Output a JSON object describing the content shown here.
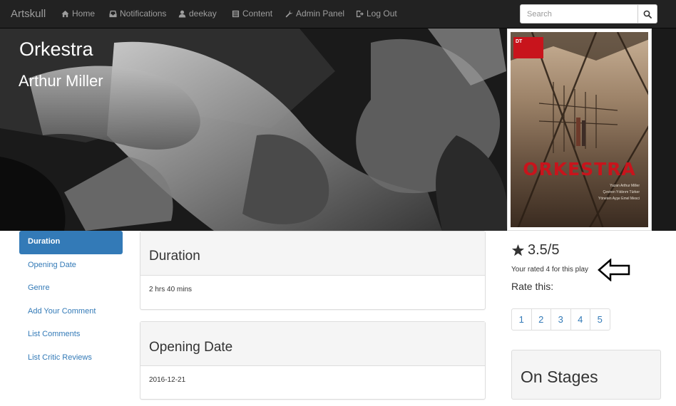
{
  "navbar": {
    "brand": "Artskull",
    "items": [
      {
        "label": "Home",
        "icon": "home-icon"
      },
      {
        "label": "Notifications",
        "icon": "inbox-icon"
      },
      {
        "label": "deekay",
        "icon": "user-icon"
      },
      {
        "label": "Content",
        "icon": "list-icon"
      },
      {
        "label": "Admin Panel",
        "icon": "wrench-icon"
      },
      {
        "label": "Log Out",
        "icon": "logout-icon"
      }
    ],
    "search_placeholder": "Search"
  },
  "hero": {
    "title": "Orkestra",
    "author": "Arthur Miller"
  },
  "poster": {
    "title": "ORKESTRA",
    "logo_text": "DT",
    "credits": [
      "Yazan Arthur Miller",
      "Çeviren Yıldırım Türker",
      "Yöneten Ayşe Emel Mesci"
    ]
  },
  "sidebar": {
    "items": [
      {
        "label": "Duration",
        "active": true
      },
      {
        "label": "Opening Date",
        "active": false
      },
      {
        "label": "Genre",
        "active": false
      },
      {
        "label": "Add Your Comment",
        "active": false
      },
      {
        "label": "List Comments",
        "active": false
      },
      {
        "label": "List Critic Reviews",
        "active": false
      }
    ]
  },
  "panels": {
    "duration": {
      "heading": "Duration",
      "body": "2 hrs 40 mins"
    },
    "opening_date": {
      "heading": "Opening Date",
      "body": "2016-12-21"
    }
  },
  "rating": {
    "score": "3.5/5",
    "user_rated_text": "Your rated 4 for this play",
    "rate_label": "Rate this:",
    "options": [
      "1",
      "2",
      "3",
      "4",
      "5"
    ]
  },
  "stages": {
    "heading": "On Stages"
  },
  "colors": {
    "navbar_bg": "#222222",
    "link": "#337ab7",
    "active_bg": "#337ab7",
    "poster_title": "#c8141c"
  }
}
